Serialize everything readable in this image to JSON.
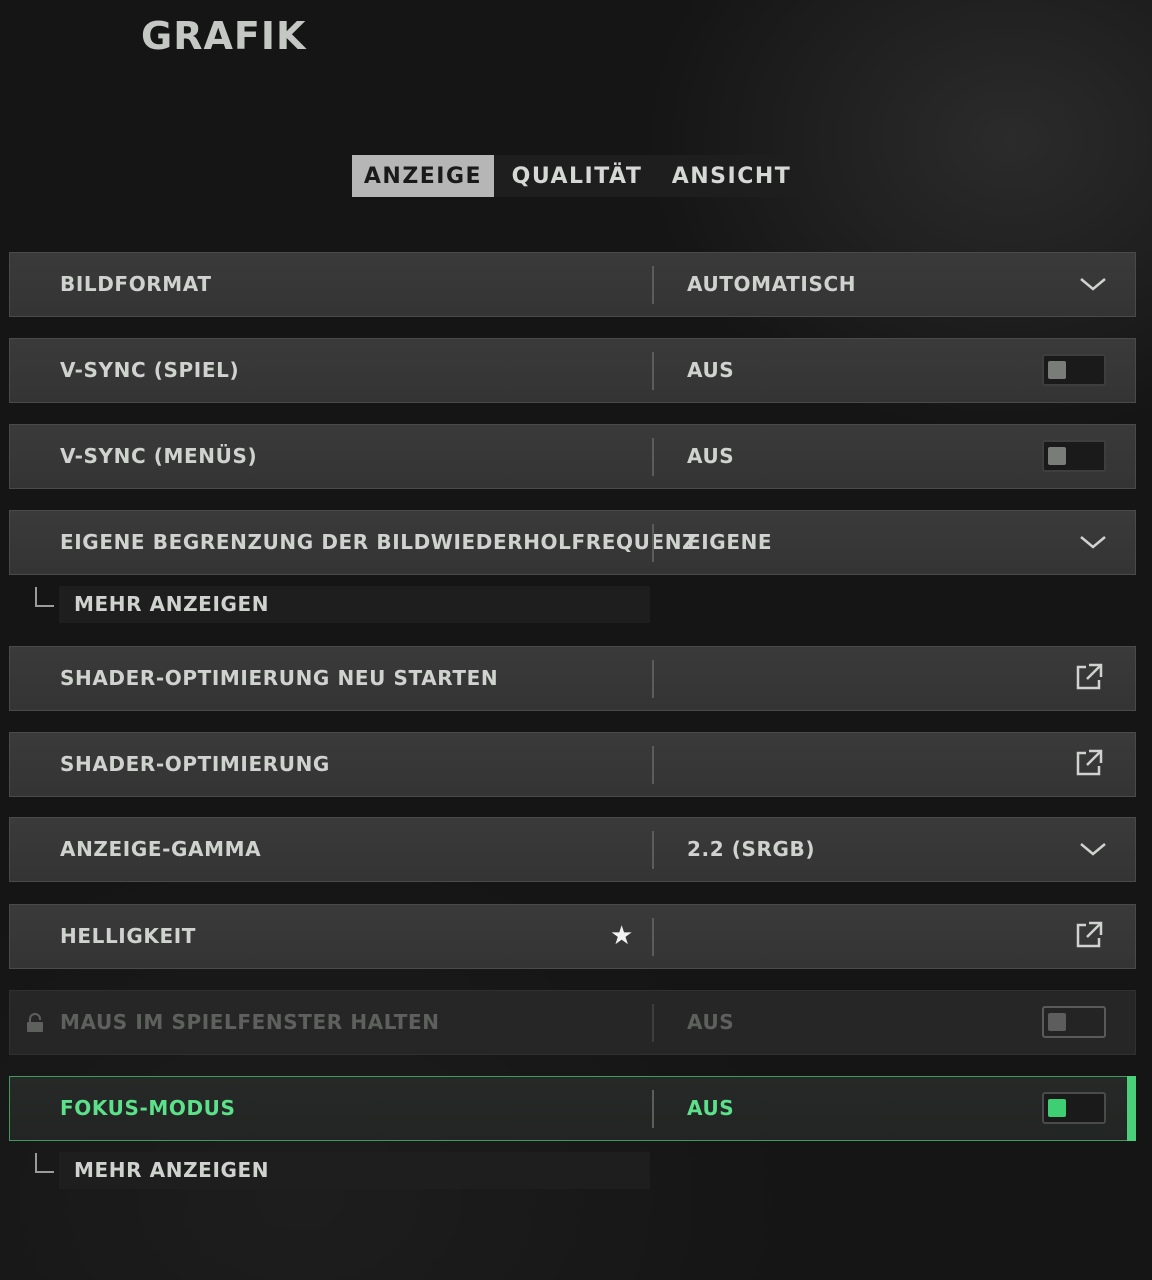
{
  "page": {
    "title": "GRAFIK"
  },
  "tabs": [
    {
      "label": "ANZEIGE",
      "active": true
    },
    {
      "label": "QUALITÄT",
      "active": false
    },
    {
      "label": "ANSICHT",
      "active": false
    }
  ],
  "settings": [
    {
      "label": "BILDFORMAT",
      "value": "AUTOMATISCH",
      "control": "dropdown"
    },
    {
      "label": "V-SYNC (SPIEL)",
      "value": "AUS",
      "control": "toggle",
      "on": false
    },
    {
      "label": "V-SYNC (MENÜS)",
      "value": "AUS",
      "control": "toggle",
      "on": false
    },
    {
      "label": "EIGENE BEGRENZUNG DER BILDWIEDERHOLFREQUENZ",
      "value": "EIGENE",
      "control": "dropdown"
    },
    {
      "label": "SHADER-OPTIMIERUNG NEU STARTEN",
      "value": "",
      "control": "external"
    },
    {
      "label": "SHADER-OPTIMIERUNG",
      "value": "",
      "control": "external"
    },
    {
      "label": "ANZEIGE-GAMMA",
      "value": "2.2 (SRGB)",
      "control": "dropdown"
    },
    {
      "label": "HELLIGKEIT",
      "value": "",
      "control": "external",
      "starred": true
    },
    {
      "label": "MAUS IM SPIELFENSTER HALTEN",
      "value": "AUS",
      "control": "toggle",
      "on": false,
      "locked": true
    },
    {
      "label": "FOKUS-MODUS",
      "value": "AUS",
      "control": "toggle",
      "on": false,
      "focused": true
    }
  ],
  "more_buttons": [
    {
      "label": "MEHR ANZEIGEN"
    },
    {
      "label": "MEHR ANZEIGEN"
    }
  ],
  "colors": {
    "accent_green": "#4bd07a",
    "row_bg": "#383838",
    "tab_active_bg": "#b5b6b5"
  },
  "icons": {
    "dropdown": "chevron-down-icon",
    "external": "external-link-icon",
    "star": "star-icon",
    "lock": "lock-icon"
  }
}
